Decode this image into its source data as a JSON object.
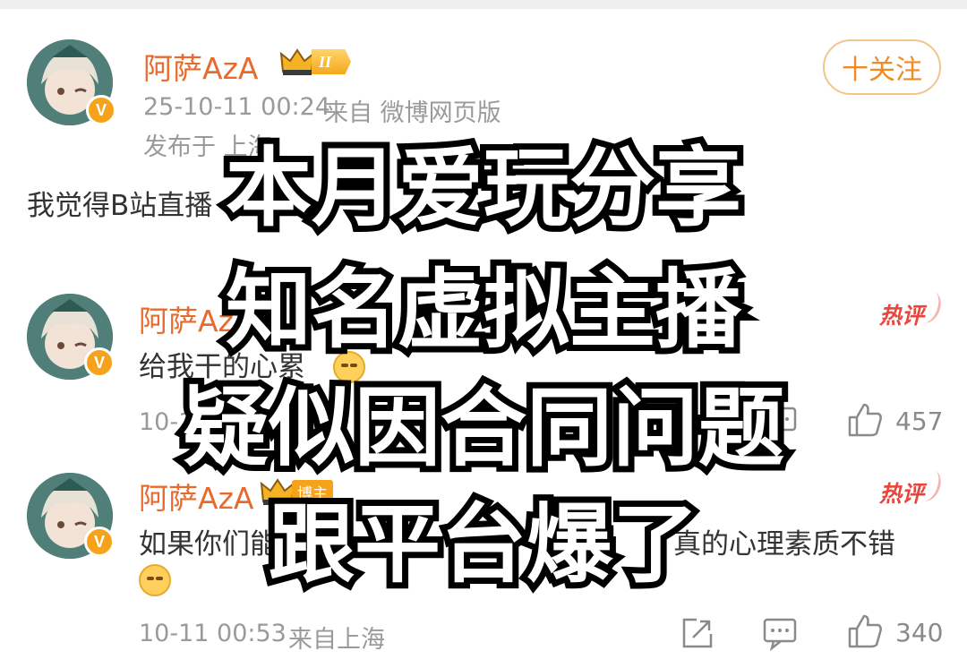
{
  "post": {
    "username": "阿萨AzA",
    "level_badge": "II",
    "follow_label": "十关注",
    "timestamp": "25-10-11 00:24",
    "source": "来自 微博网页版",
    "location": "发布于 上海",
    "content": "我觉得B站直播"
  },
  "comments": [
    {
      "username": "阿萨AzA",
      "hot_label": "热评",
      "content": "给我干的心累",
      "time": "10-1",
      "likes": "457"
    },
    {
      "username": "阿萨AzA",
      "author_badge": "博主",
      "hot_label": "热评",
      "content": "如果你们能",
      "content_tail": "真的心理素质不错",
      "time": "10-11 00:53",
      "source": "来自上海",
      "likes": "340"
    }
  ],
  "overlay": {
    "line1": "本月爱玩分享",
    "line2": "知名虚拟主播",
    "line3": "疑似因合同问题",
    "line4": "跟平台爆了"
  },
  "colors": {
    "username": "#e86b2e",
    "meta": "#9a9a9a",
    "follow_border": "#f2c58a",
    "hot": "#e8453c",
    "badge_gold": "#f6a31b"
  },
  "icons": [
    "crown-icon",
    "verified-icon",
    "share-icon",
    "comment-icon",
    "like-icon",
    "emoji-icon"
  ]
}
